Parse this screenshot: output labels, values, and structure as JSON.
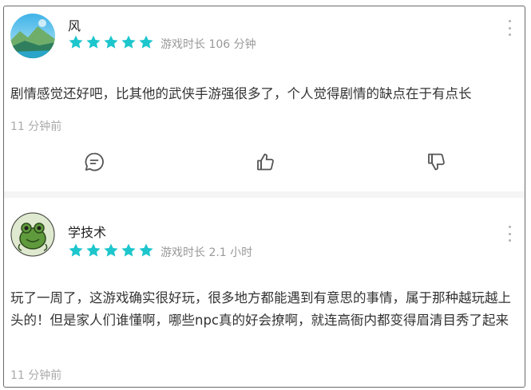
{
  "accent_color": "#1cc6cc",
  "reviews": [
    {
      "username": "风",
      "rating": 5,
      "playtime": "游戏时长 106 分钟",
      "content": "剧情感觉还好吧，比其他的武侠手游强很多了，个人觉得剧情的缺点在于有点长",
      "time": "11 分钟前",
      "avatar_icon": "landscape-avatar",
      "actions": [
        "comment-icon",
        "thumbs-up-icon",
        "thumbs-down-icon"
      ]
    },
    {
      "username": "学技术",
      "rating": 5,
      "playtime": "游戏时长 2.1 小时",
      "content": "玩了一周了，这游戏确实很好玩，很多地方都能遇到有意思的事情，属于那种越玩越上头的！但是家人们谁懂啊，哪些npc真的好会撩啊，就连高衙内都变得眉清目秀了起来",
      "time": "11 分钟前",
      "avatar_icon": "frog-avatar"
    }
  ]
}
